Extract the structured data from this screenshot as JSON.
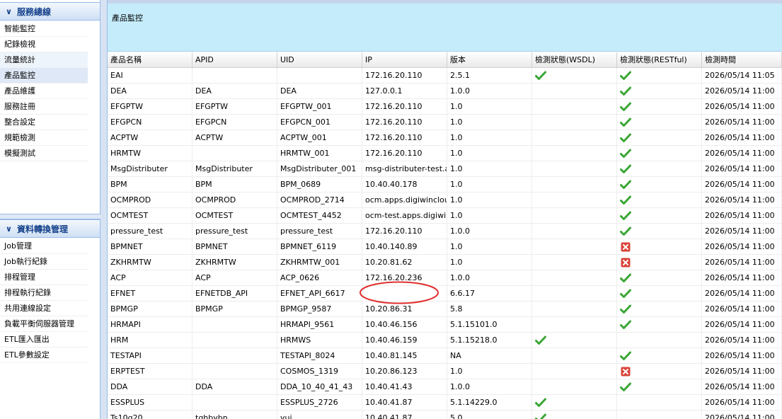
{
  "sidebar": {
    "section1": {
      "title": "服務總線",
      "items": [
        "智能監控",
        "紀錄檢視",
        "流量統計",
        "產品監控",
        "產品維護",
        "服務註冊",
        "整合設定",
        "規範檢測",
        "模擬測試"
      ]
    },
    "section2": {
      "title": "資料轉換管理",
      "items": [
        "Job管理",
        "Job執行紀錄",
        "排程管理",
        "排程執行紀錄",
        "共用連線設定",
        "負載平衡伺服器管理",
        "ETL匯入匯出",
        "ETL參數設定"
      ]
    }
  },
  "main": {
    "title": "產品監控",
    "columns": [
      "產品名稱",
      "APID",
      "UID",
      "IP",
      "版本",
      "檢測狀態(WSDL)",
      "檢測狀態(RESTful)",
      "檢測時間"
    ],
    "rows": [
      {
        "name": "EAI",
        "apid": "",
        "uid": "",
        "ip": "172.16.20.110",
        "version": "2.5.1",
        "wsdl": "ok",
        "rest": "ok",
        "time": "2026/05/14 11:05"
      },
      {
        "name": "DEA",
        "apid": "DEA",
        "uid": "DEA",
        "ip": "127.0.0.1",
        "version": "1.0.0",
        "wsdl": "",
        "rest": "ok",
        "time": "2026/05/14 11:00"
      },
      {
        "name": "EFGPTW",
        "apid": "EFGPTW",
        "uid": "EFGPTW_001",
        "ip": "172.16.20.110",
        "version": "1.0",
        "wsdl": "",
        "rest": "ok",
        "time": "2026/05/14 11:00"
      },
      {
        "name": "EFGPCN",
        "apid": "EFGPCN",
        "uid": "EFGPCN_001",
        "ip": "172.16.20.110",
        "version": "1.0",
        "wsdl": "",
        "rest": "ok",
        "time": "2026/05/14 11:00"
      },
      {
        "name": "ACPTW",
        "apid": "ACPTW",
        "uid": "ACPTW_001",
        "ip": "172.16.20.110",
        "version": "1.0",
        "wsdl": "",
        "rest": "ok",
        "time": "2026/05/14 11:00"
      },
      {
        "name": "HRMTW",
        "apid": "",
        "uid": "HRMTW_001",
        "ip": "172.16.20.110",
        "version": "1.0",
        "wsdl": "",
        "rest": "ok",
        "time": "2026/05/14 11:00"
      },
      {
        "name": "MsgDistributer",
        "apid": "MsgDistributer",
        "uid": "MsgDistributer_001",
        "ip": "msg-distributer-test.app",
        "version": "1.0",
        "wsdl": "",
        "rest": "ok",
        "time": "2026/05/14 11:00"
      },
      {
        "name": "BPM",
        "apid": "BPM",
        "uid": "BPM_0689",
        "ip": "10.40.40.178",
        "version": "1.0",
        "wsdl": "",
        "rest": "ok",
        "time": "2026/05/14 11:00"
      },
      {
        "name": "OCMPROD",
        "apid": "OCMPROD",
        "uid": "OCMPROD_2714",
        "ip": "ocm.apps.digiwincloud.c",
        "version": "1.0",
        "wsdl": "",
        "rest": "ok",
        "time": "2026/05/14 11:00"
      },
      {
        "name": "OCMTEST",
        "apid": "OCMTEST",
        "uid": "OCMTEST_4452",
        "ip": "ocm-test.apps.digiwinclo",
        "version": "1.0",
        "wsdl": "",
        "rest": "ok",
        "time": "2026/05/14 11:00"
      },
      {
        "name": "pressure_test",
        "apid": "pressure_test",
        "uid": "pressure_test",
        "ip": "172.16.20.110",
        "version": "1.0.0",
        "wsdl": "",
        "rest": "ok",
        "time": "2026/05/14 11:00"
      },
      {
        "name": "BPMNET",
        "apid": "BPMNET",
        "uid": "BPMNET_6119",
        "ip": "10.40.140.89",
        "version": "1.0",
        "wsdl": "",
        "rest": "fail",
        "time": "2026/05/14 11:00"
      },
      {
        "name": "ZKHRMTW",
        "apid": "ZKHRMTW",
        "uid": "ZKHRMTW_001",
        "ip": "10.20.81.62",
        "version": "1.0",
        "wsdl": "",
        "rest": "fail",
        "time": "2026/05/14 11:00"
      },
      {
        "name": "ACP",
        "apid": "ACP",
        "uid": "ACP_0626",
        "ip": "172.16.20.236",
        "version": "1.0.0",
        "wsdl": "",
        "rest": "ok",
        "time": "2026/05/14 11:00"
      },
      {
        "name": "EFNET",
        "apid": "EFNETDB_API",
        "uid": "EFNET_API_6617",
        "ip": "",
        "version": "6.6.17",
        "wsdl": "",
        "rest": "ok",
        "time": "2026/05/14 11:00"
      },
      {
        "name": "BPMGP",
        "apid": "BPMGP",
        "uid": "BPMGP_9587",
        "ip": "10.20.86.31",
        "version": "5.8",
        "wsdl": "",
        "rest": "ok",
        "time": "2026/05/14 11:00"
      },
      {
        "name": "HRMAPI",
        "apid": "",
        "uid": "HRMAPI_9561",
        "ip": "10.40.46.156",
        "version": "5.1.15101.0",
        "wsdl": "",
        "rest": "ok",
        "time": "2026/05/14 11:00"
      },
      {
        "name": "HRM",
        "apid": "",
        "uid": "HRMWS",
        "ip": "10.40.46.159",
        "version": "5.1.15218.0",
        "wsdl": "ok",
        "rest": "",
        "time": "2026/05/14 11:00"
      },
      {
        "name": "TESTAPI",
        "apid": "",
        "uid": "TESTAPI_8024",
        "ip": "10.40.81.145",
        "version": "NA",
        "wsdl": "",
        "rest": "ok",
        "time": "2026/05/14 11:00"
      },
      {
        "name": "ERPTEST",
        "apid": "",
        "uid": "COSMOS_1319",
        "ip": "10.20.86.123",
        "version": "1.0",
        "wsdl": "",
        "rest": "fail",
        "time": "2026/05/14 11:00"
      },
      {
        "name": "DDA",
        "apid": "DDA",
        "uid": "DDA_10_40_41_43",
        "ip": "10.40.41.43",
        "version": "1.0.0",
        "wsdl": "",
        "rest": "ok",
        "time": "2026/05/14 11:00"
      },
      {
        "name": "ESSPLUS",
        "apid": "",
        "uid": "ESSPLUS_2726",
        "ip": "10.40.41.87",
        "version": "5.1.14229.0",
        "wsdl": "ok",
        "rest": "",
        "time": "2026/05/14 11:00"
      },
      {
        "name": "Ts10g20",
        "apid": "tghbybn",
        "uid": "yui",
        "ip": "10.40.41.87",
        "version": "5.0",
        "wsdl": "ok",
        "rest": "",
        "time": "2026/05/14 11:00"
      }
    ]
  },
  "colors": {
    "ok": "#3aa635",
    "fail": "#d9443a",
    "annotation": "#e03030"
  }
}
